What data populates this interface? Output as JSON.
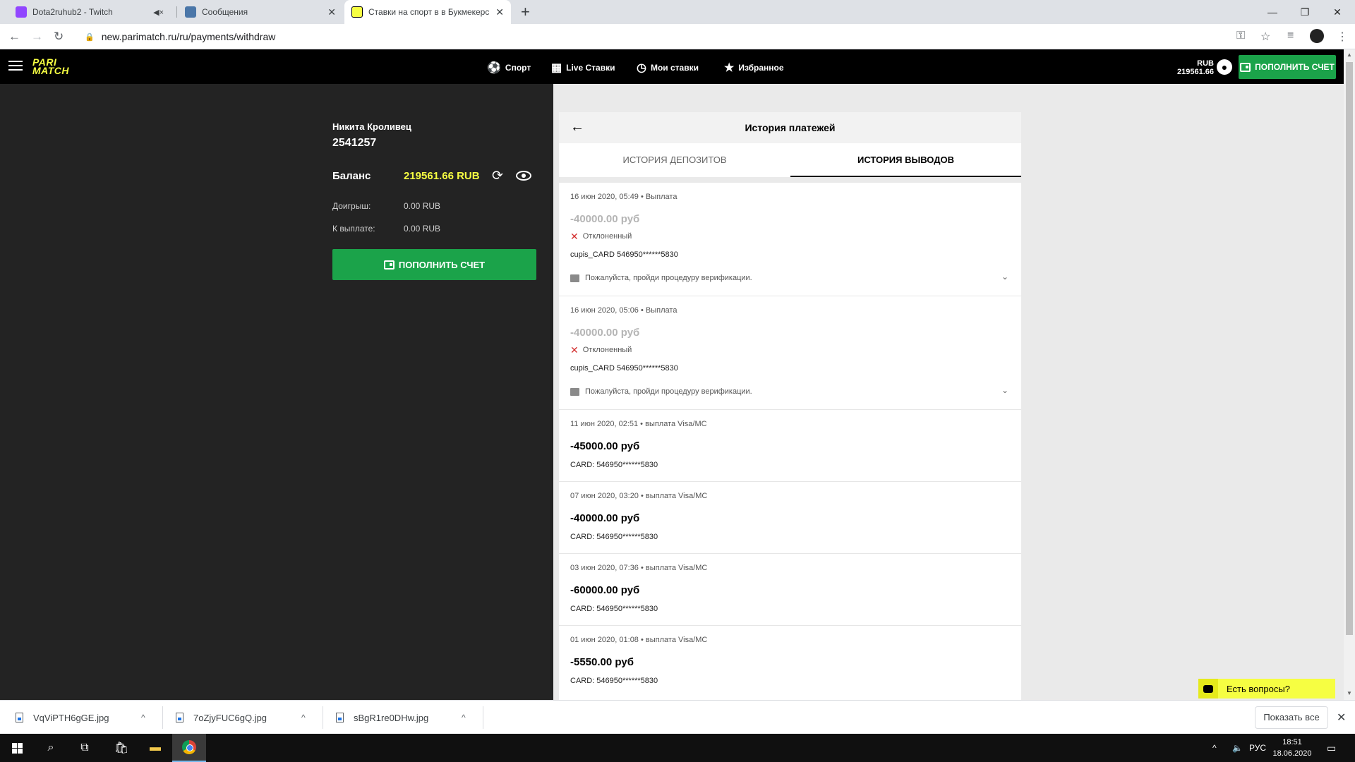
{
  "browser": {
    "tabs": [
      {
        "title": "Dota2ruhub2 - Twitch",
        "favicon_color": "#9146ff",
        "muted": true
      },
      {
        "title": "Сообщения",
        "favicon_color": "#4a76a8",
        "muted": false
      },
      {
        "title": "Ставки на спорт в в Букмекерс",
        "favicon_color": "#f6fe42",
        "muted": false,
        "active": true
      }
    ],
    "url": "new.parimatch.ru/ru/payments/withdraw"
  },
  "site": {
    "logo_line1": "PARI",
    "logo_line2": "MATCH",
    "brand_yellow": "#f6fe42",
    "brand_green": "#1ba34a",
    "nav": [
      {
        "label": "Спорт",
        "icon": "soccer-ball-icon"
      },
      {
        "label": "Live Ставки",
        "icon": "calendar-icon"
      },
      {
        "label": "Мои ставки",
        "icon": "clock-icon"
      },
      {
        "label": "Избранное",
        "icon": "star-icon"
      }
    ],
    "header_currency": "RUB",
    "header_balance": "219561.66",
    "deposit_label": "ПОПОЛНИТЬ СЧЕТ"
  },
  "account": {
    "name": "Никита Кроливец",
    "id": "2541257",
    "balance_label": "Баланс",
    "balance_value": "219561.66 RUB",
    "rows": [
      {
        "label": "Доигрыш:",
        "value": "0.00 RUB"
      },
      {
        "label": "К выплате:",
        "value": "0.00 RUB"
      }
    ],
    "deposit_label": "ПОПОЛНИТЬ СЧЕТ"
  },
  "history": {
    "title": "История платежей",
    "tab_deposits": "ИСТОРИЯ ДЕПОЗИТОВ",
    "tab_withdrawals": "ИСТОРИЯ ВЫВОДОВ",
    "transactions": [
      {
        "date": "16 июн 2020, 05:49",
        "type": "Выплата",
        "amount": "-40000.00 руб",
        "status": "Отклоненный",
        "card": "cupis_CARD 546950******5830",
        "note": "Пожалуйста, пройди процедуру верификации.",
        "rejected": true
      },
      {
        "date": "16 июн 2020, 05:06",
        "type": "Выплата",
        "amount": "-40000.00 руб",
        "status": "Отклоненный",
        "card": "cupis_CARD 546950******5830",
        "note": "Пожалуйста, пройди процедуру верификации.",
        "rejected": true
      },
      {
        "date": "11 июн 2020, 02:51",
        "type": "выплата Visa/MC",
        "amount": "-45000.00 руб",
        "card": "CARD: 546950******5830",
        "rejected": false
      },
      {
        "date": "07 июн 2020, 03:20",
        "type": "выплата Visa/MC",
        "amount": "-40000.00 руб",
        "card": "CARD: 546950******5830",
        "rejected": false
      },
      {
        "date": "03 июн 2020, 07:36",
        "type": "выплата Visa/MC",
        "amount": "-60000.00 руб",
        "card": "CARD: 546950******5830",
        "rejected": false
      },
      {
        "date": "01 июн 2020, 01:08",
        "type": "выплата Visa/MC",
        "amount": "-5550.00 руб",
        "card": "CARD: 546950******5830",
        "rejected": false
      }
    ]
  },
  "chat": {
    "label": "Есть вопросы?"
  },
  "downloads": {
    "files": [
      "VqViPTH6gGE.jpg",
      "7oZjyFUC6gQ.jpg",
      "sBgR1re0DHw.jpg"
    ],
    "show_all": "Показать все"
  },
  "taskbar": {
    "lang": "РУС",
    "time": "18:51",
    "date": "18.06.2020"
  }
}
